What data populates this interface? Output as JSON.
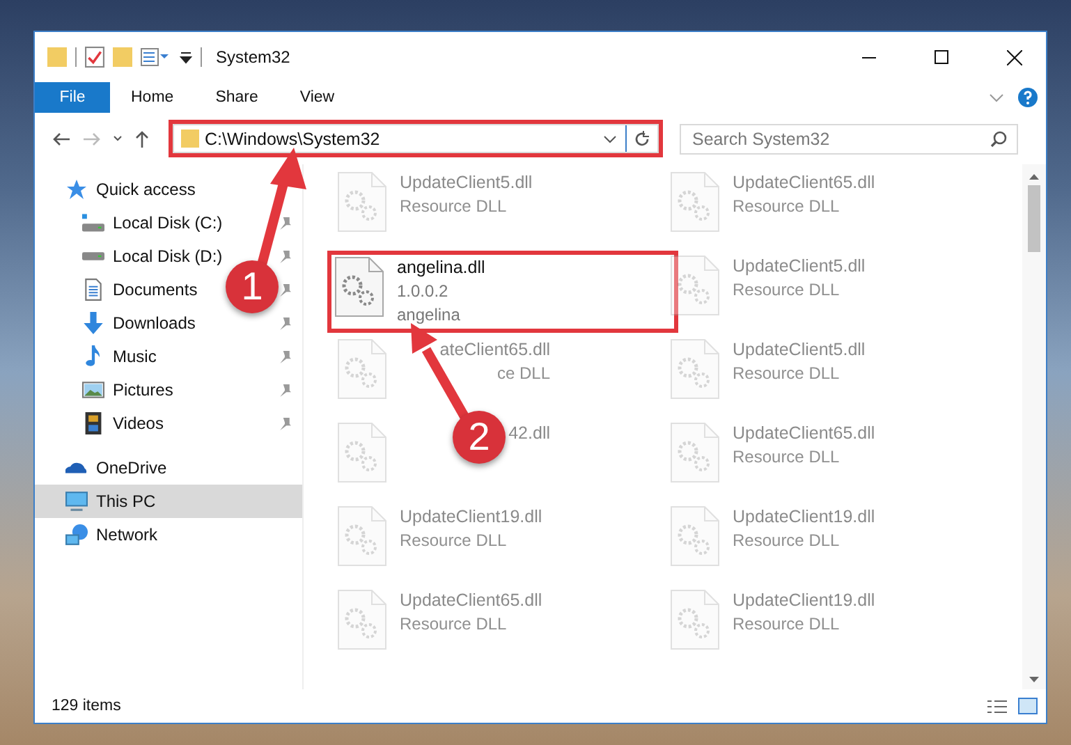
{
  "window": {
    "title": "System32"
  },
  "ribbon_tabs": [
    {
      "label": "File",
      "selected": true
    },
    {
      "label": "Home",
      "selected": false
    },
    {
      "label": "Share",
      "selected": false
    },
    {
      "label": "View",
      "selected": false
    }
  ],
  "address": {
    "path": "C:\\Windows\\System32",
    "highlighted": true
  },
  "search": {
    "placeholder": "Search System32"
  },
  "nav": [
    {
      "label": "Quick access",
      "kind": "star",
      "selected": false,
      "children": [
        {
          "label": "Local Disk (C:)",
          "kind": "system-disk",
          "pinned": true,
          "selected": false
        },
        {
          "label": "Local Disk (D:)",
          "kind": "disk",
          "pinned": true,
          "selected": false
        },
        {
          "label": "Documents",
          "kind": "documents",
          "pinned": true,
          "selected": false
        },
        {
          "label": "Downloads",
          "kind": "downloads",
          "pinned": true,
          "selected": false
        },
        {
          "label": "Music",
          "kind": "music",
          "pinned": true,
          "selected": false
        },
        {
          "label": "Pictures",
          "kind": "pictures",
          "pinned": true,
          "selected": false
        },
        {
          "label": "Videos",
          "kind": "videos",
          "pinned": true,
          "selected": false
        }
      ]
    },
    {
      "label": "OneDrive",
      "kind": "cloud",
      "selected": false
    },
    {
      "label": "This PC",
      "kind": "computer",
      "selected": true
    },
    {
      "label": "Network",
      "kind": "network",
      "selected": false
    }
  ],
  "files": [
    {
      "name": "UpdateClient5.dll",
      "details": [
        "Resource DLL"
      ],
      "faded": true,
      "highlighted": false
    },
    {
      "name": "UpdateClient65.dll",
      "details": [
        "Resource DLL"
      ],
      "faded": true,
      "highlighted": false
    },
    {
      "name": "angelina.dll",
      "details": [
        "1.0.0.2",
        "angelina"
      ],
      "faded": false,
      "highlighted": true
    },
    {
      "name": "UpdateClient5.dll",
      "details": [
        "Resource DLL"
      ],
      "faded": true,
      "highlighted": false
    },
    {
      "name": "ateClient65.dll",
      "details": [
        "ce DLL"
      ],
      "faded": true,
      "highlighted": false,
      "kind": "covered"
    },
    {
      "name": "UpdateClient5.dll",
      "details": [
        "Resource DLL"
      ],
      "faded": true,
      "highlighted": false
    },
    {
      "name": "42.dll",
      "faded": true,
      "highlighted": false,
      "kind": "covered"
    },
    {
      "name": "UpdateClient65.dll",
      "details": [
        "Resource DLL"
      ],
      "faded": true,
      "highlighted": false
    },
    {
      "name": "UpdateClient19.dll",
      "details": [
        "Resource DLL"
      ],
      "faded": true,
      "highlighted": false
    },
    {
      "name": "UpdateClient19.dll",
      "details": [
        "Resource DLL"
      ],
      "faded": true,
      "highlighted": false
    },
    {
      "name": "UpdateClient65.dll",
      "details": [
        "Resource DLL"
      ],
      "faded": true,
      "highlighted": false
    },
    {
      "name": "UpdateClient19.dll",
      "details": [
        "Resource DLL"
      ],
      "faded": true,
      "highlighted": false
    }
  ],
  "status_bar": {
    "count": "129 items"
  },
  "annotations": [
    {
      "number": "1",
      "kind": "address-pointer"
    },
    {
      "number": "2",
      "kind": "file-pointer"
    }
  ]
}
